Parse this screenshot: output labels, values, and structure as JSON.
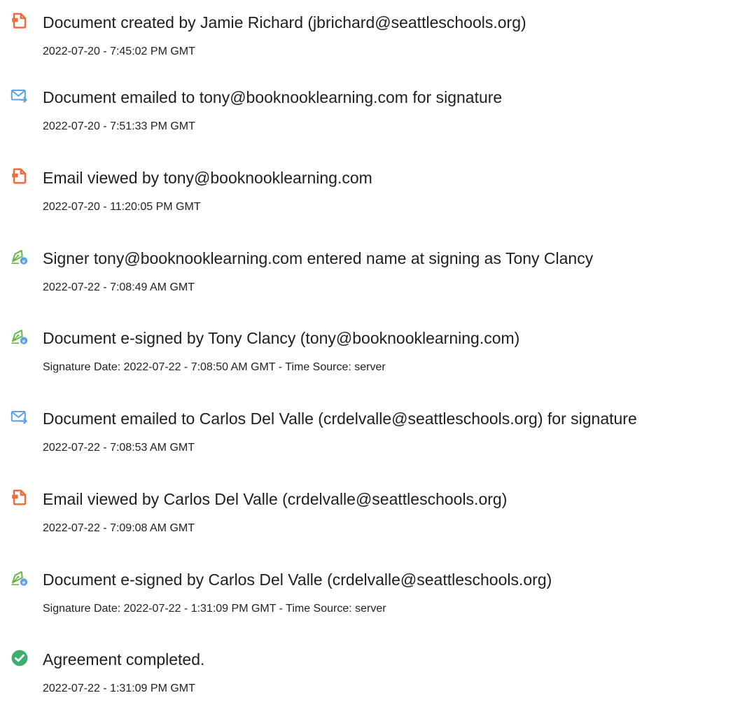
{
  "colors": {
    "document_icon": "#F26B3A",
    "email_icon": "#5E9FE6",
    "sign_icon": "#69B64A",
    "check_icon": "#3AAE6A"
  },
  "entries": [
    {
      "icon": "document-icon",
      "title": "Document created by Jamie Richard (jbrichard@seattleschools.org)",
      "meta": "2022-07-20 - 7:45:02 PM GMT"
    },
    {
      "icon": "email-icon",
      "title": "Document emailed to tony@booknooklearning.com for signature",
      "meta": "2022-07-20 - 7:51:33 PM GMT"
    },
    {
      "icon": "document-icon",
      "title": "Email viewed by tony@booknooklearning.com",
      "meta": "2022-07-20 - 11:20:05 PM GMT"
    },
    {
      "icon": "sign-icon",
      "title": "Signer tony@booknooklearning.com entered name at signing as Tony Clancy",
      "meta": "2022-07-22 - 7:08:49 AM GMT"
    },
    {
      "icon": "sign-icon",
      "title": "Document e-signed by Tony Clancy (tony@booknooklearning.com)",
      "meta": "Signature Date: 2022-07-22 - 7:08:50 AM GMT - Time Source: server"
    },
    {
      "icon": "email-icon",
      "title": "Document emailed to Carlos Del Valle (crdelvalle@seattleschools.org) for signature",
      "meta": "2022-07-22 - 7:08:53 AM GMT"
    },
    {
      "icon": "document-icon",
      "title": "Email viewed by Carlos Del Valle (crdelvalle@seattleschools.org)",
      "meta": "2022-07-22 - 7:09:08 AM GMT"
    },
    {
      "icon": "sign-icon",
      "title": "Document e-signed by Carlos Del Valle (crdelvalle@seattleschools.org)",
      "meta": "Signature Date: 2022-07-22 - 1:31:09 PM GMT - Time Source: server"
    },
    {
      "icon": "check-icon",
      "title": "Agreement completed.",
      "meta": "2022-07-22 - 1:31:09 PM GMT"
    }
  ]
}
